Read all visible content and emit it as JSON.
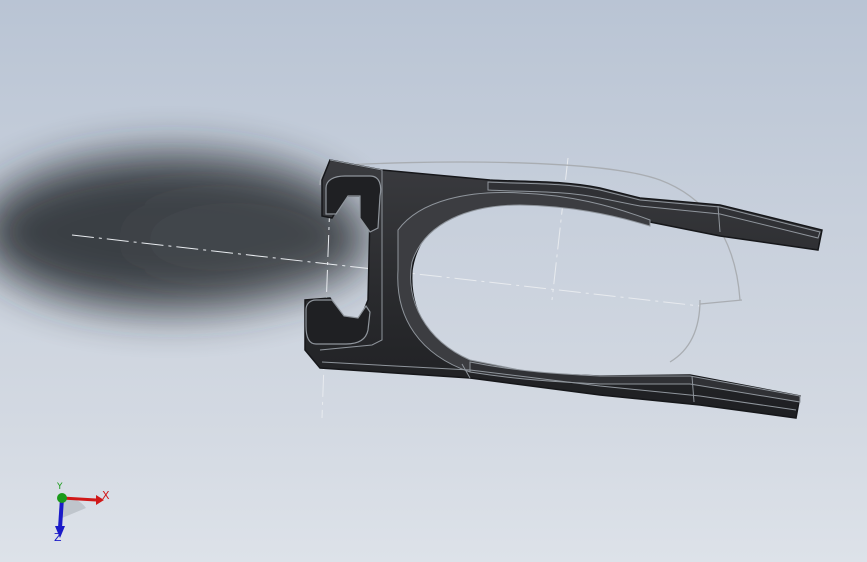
{
  "viewport": {
    "background_top": "#b9c4d4",
    "background_bottom": "#dde2e9",
    "model_color": "#2a2b2e",
    "edge_color": "#8f959c",
    "sketch_color": "#a9adb2"
  },
  "triad": {
    "x_label": "X",
    "y_label": "Y",
    "z_label": "Z",
    "x_color": "#d01818",
    "y_color": "#1a9a1a",
    "z_color": "#1a1ac8"
  }
}
